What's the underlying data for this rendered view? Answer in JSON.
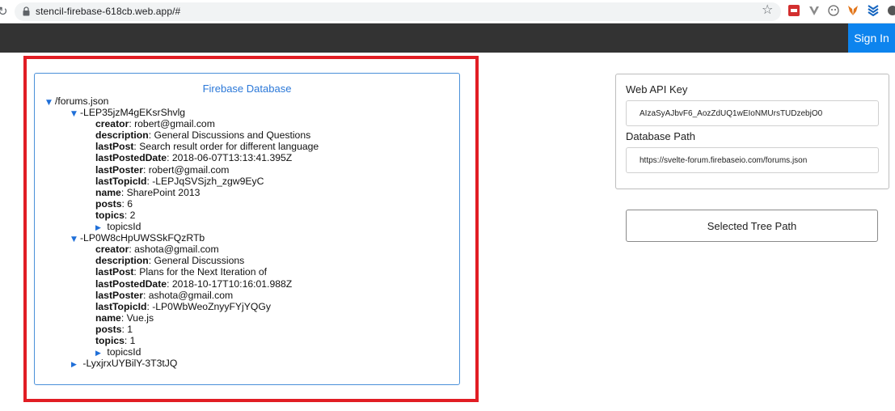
{
  "browser": {
    "url": "stencil-firebase-618cb.web.app/#",
    "extensions": [
      "cbs-extension-icon",
      "vuetify-extension-icon",
      "circle-extension-icon",
      "metamask-fox-icon",
      "layers-extension-icon",
      "globe-extension-icon"
    ]
  },
  "header": {
    "sign_in_label": "Sign In"
  },
  "tree": {
    "title": "Firebase Database",
    "root": "/forums.json",
    "nodes": [
      {
        "key": "-LEP35jzM4gEKsrShvlg",
        "fields": [
          {
            "k": "creator",
            "v": ": robert@gmail.com"
          },
          {
            "k": "description",
            "v": ": General Discussions and Questions"
          },
          {
            "k": "lastPost",
            "v": ": Search result order for different language"
          },
          {
            "k": "lastPostedDate",
            "v": ": 2018-06-07T13:13:41.395Z"
          },
          {
            "k": "lastPoster",
            "v": ": robert@gmail.com"
          },
          {
            "k": "lastTopicId",
            "v": ": -LEPJqSVSjzh_zgw9EyC"
          },
          {
            "k": "name",
            "v": ": SharePoint 2013"
          },
          {
            "k": "posts",
            "v": ": 6"
          },
          {
            "k": "topics",
            "v": ": 2"
          }
        ],
        "child": "topicsId"
      },
      {
        "key": "-LP0W8cHpUWSSkFQzRTb",
        "fields": [
          {
            "k": "creator",
            "v": ": ashota@gmail.com"
          },
          {
            "k": "description",
            "v": ": General Discussions"
          },
          {
            "k": "lastPost",
            "v": ": Plans for the Next Iteration of"
          },
          {
            "k": "lastPostedDate",
            "v": ": 2018-10-17T10:16:01.988Z"
          },
          {
            "k": "lastPoster",
            "v": ": ashota@gmail.com"
          },
          {
            "k": "lastTopicId",
            "v": ": -LP0WbWeoZnyyFYjYQGy"
          },
          {
            "k": "name",
            "v": ": Vue.js"
          },
          {
            "k": "posts",
            "v": ": 1"
          },
          {
            "k": "topics",
            "v": ": 1"
          }
        ],
        "child": "topicsId"
      },
      {
        "key": "-LyxjrxUYBilY-3T3tJQ",
        "collapsed": true
      }
    ]
  },
  "config": {
    "api_key_label": "Web API Key",
    "api_key_value": "AIzaSyAJbvF6_AozZdUQ1wEIoNMUrsTUDzebjO0",
    "db_path_label": "Database Path",
    "db_path_value": "https://svelte-forum.firebaseio.com/forums.json",
    "selected_tree_path_label": "Selected Tree Path"
  },
  "colors": {
    "accent": "#0d84ee",
    "highlight": "#e11d24",
    "tree_title": "#2b78d8",
    "header_bg": "#333333"
  }
}
